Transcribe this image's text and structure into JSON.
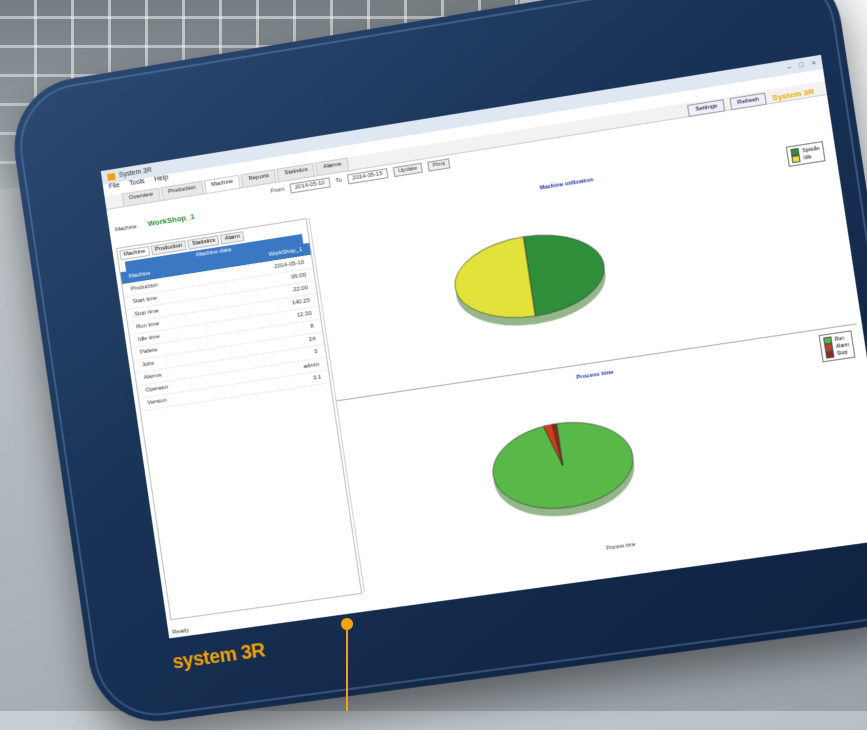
{
  "app": {
    "title": "System 3R",
    "window_controls": [
      "–",
      "□",
      "×"
    ],
    "menu": [
      "File",
      "Tools",
      "Help"
    ],
    "tabs": [
      "Overview",
      "Production",
      "Machine",
      "Reports",
      "Statistics",
      "Alarms"
    ],
    "machine_label": "Machine",
    "machine_name": "WorkShop_1",
    "header_buttons": [
      "Settings",
      "Refresh"
    ],
    "brand_tag": "System 3R"
  },
  "toolbar": {
    "from_label": "From",
    "from_value": "2014-05-10",
    "to_label": "To",
    "to_value": "2014-05-15",
    "update_button": "Update",
    "print_button": "Print"
  },
  "left_panel": {
    "tabs": [
      "Machine",
      "Production",
      "Statistics",
      "Alarm"
    ],
    "heading": "Machine data",
    "rows": [
      {
        "key": "Machine",
        "value": "WorkShop_1"
      },
      {
        "key": "Production",
        "value": "2014-05-10"
      },
      {
        "key": "Start time",
        "value": "06:00"
      },
      {
        "key": "Stop time",
        "value": "22:00"
      },
      {
        "key": "Run time",
        "value": "140.25"
      },
      {
        "key": "Idle time",
        "value": "12.30"
      },
      {
        "key": "Pallets",
        "value": "8"
      },
      {
        "key": "Jobs",
        "value": "24"
      },
      {
        "key": "Alarms",
        "value": "3"
      },
      {
        "key": "Operator",
        "value": "admin"
      },
      {
        "key": "Version",
        "value": "3.1"
      }
    ],
    "status": "Ready"
  },
  "chart_data": [
    {
      "type": "pie",
      "title": "Machine utilization",
      "categories": [
        "Spindle",
        "Idle"
      ],
      "values": [
        50,
        50
      ],
      "colors": [
        "#2f8f3a",
        "#e3e23a"
      ],
      "legend": [
        "Spindle",
        "Idle"
      ],
      "legend_position": "top-right"
    },
    {
      "type": "pie",
      "title": "Process time",
      "categories": [
        "Run",
        "Alarm",
        "Stop"
      ],
      "values": [
        97,
        2,
        1
      ],
      "colors": [
        "#58b848",
        "#d23a1a",
        "#8b2a1a"
      ],
      "legend": [
        "Run",
        "Alarm",
        "Stop"
      ],
      "legend_position": "top-right"
    }
  ],
  "footer": "Process time",
  "brand": "system 3R",
  "icons": [
    "app-icon",
    "camera-icon",
    "pointer-marker-icon"
  ]
}
